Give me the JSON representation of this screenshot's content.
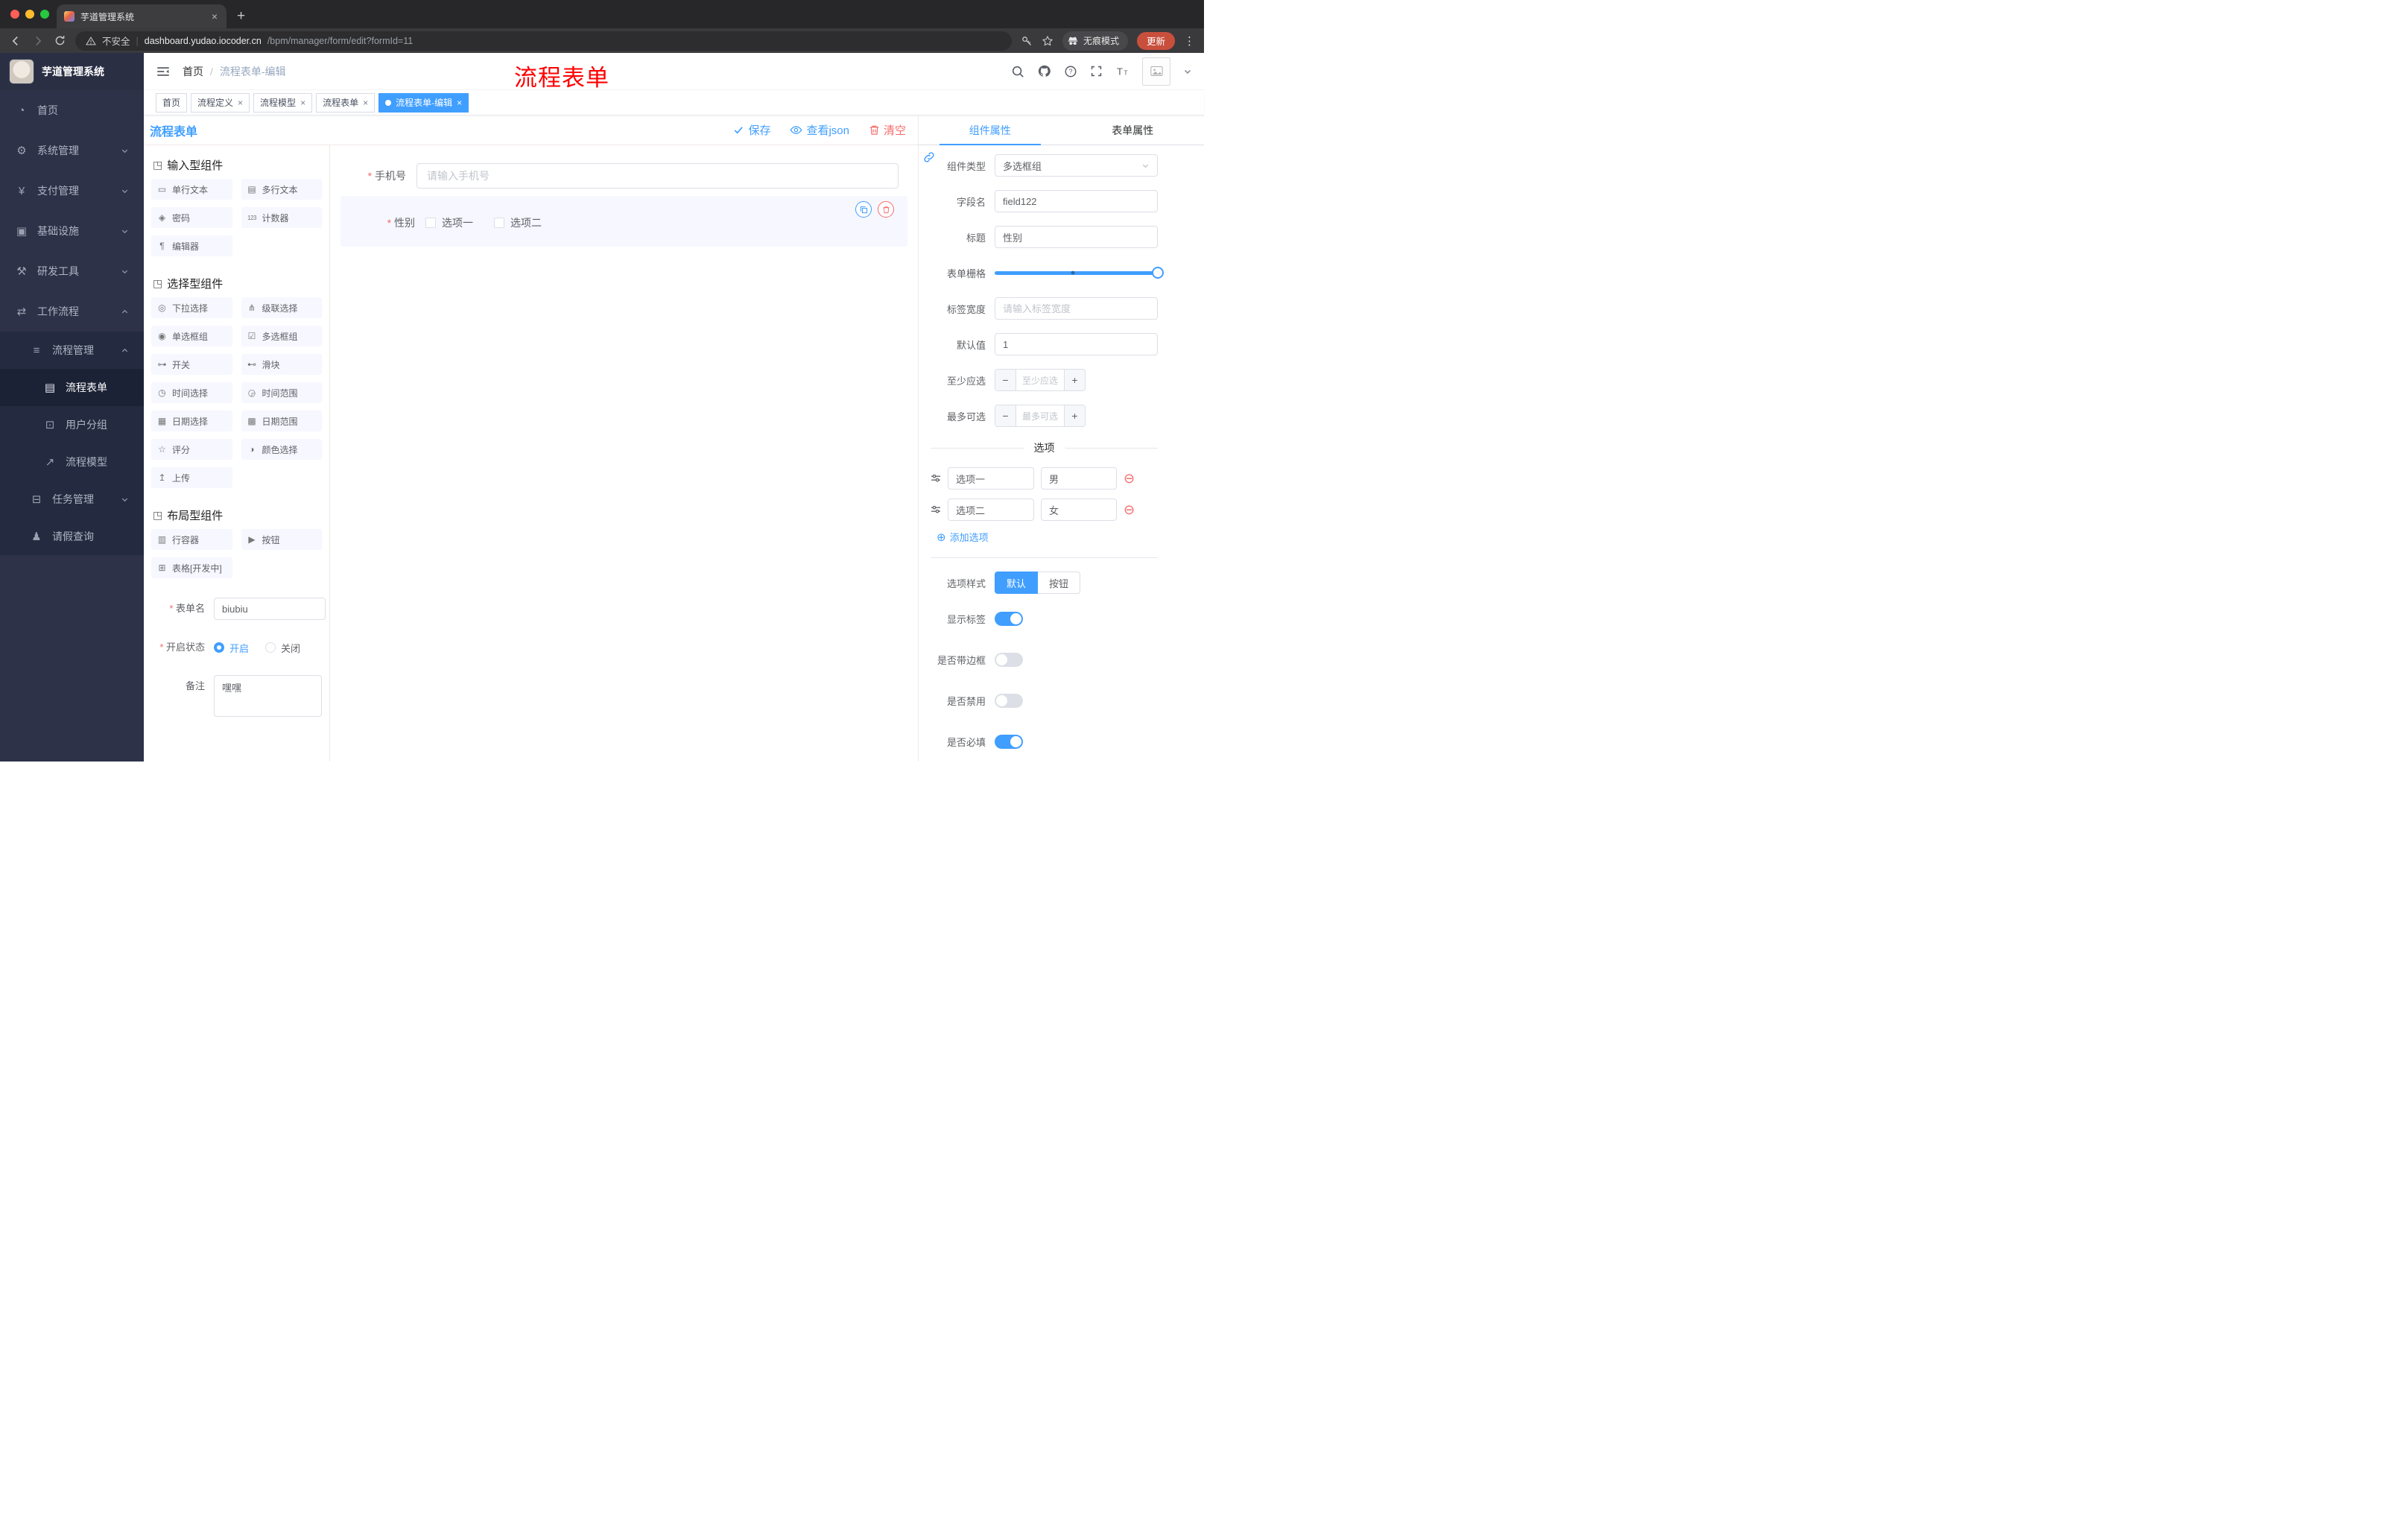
{
  "colors": {
    "primary": "#409eff",
    "danger": "#f56c6c",
    "annotation_red": "#fe0000",
    "sidebar_bg": "#2d3248",
    "selected_item_bg": "#f6f7ff"
  },
  "browser": {
    "tab_title": "芋道管理系统",
    "security_label": "不安全",
    "url_domain": "dashboard.yudao.iocoder.cn",
    "url_path": "/bpm/manager/form/edit?formId=11",
    "incognito_label": "无痕模式",
    "update_label": "更新"
  },
  "sidebar": {
    "logo_title": "芋道管理系统",
    "menu": [
      "首页",
      "系统管理",
      "支付管理",
      "基础设施",
      "研发工具",
      "工作流程"
    ],
    "process_group": "流程管理",
    "process_children": [
      "流程表单",
      "用户分组",
      "流程模型"
    ],
    "task_group": "任务管理",
    "leave_item": "请假查询"
  },
  "header": {
    "breadcrumb_home": "首页",
    "breadcrumb_separator": "/",
    "breadcrumb_current": "流程表单-编辑",
    "annotation": "流程表单"
  },
  "tags": [
    "首页",
    "流程定义",
    "流程模型",
    "流程表单",
    "流程表单-编辑"
  ],
  "editor": {
    "title": "流程表单",
    "save": "保存",
    "view_json": "查看json",
    "clear": "清空"
  },
  "palette": {
    "group_input": "输入型组件",
    "input_items": [
      "单行文本",
      "多行文本",
      "密码",
      "计数器",
      "编辑器"
    ],
    "group_select": "选择型组件",
    "select_items": [
      "下拉选择",
      "级联选择",
      "单选框组",
      "多选框组",
      "开关",
      "滑块",
      "时间选择",
      "时间范围",
      "日期选择",
      "日期范围",
      "评分",
      "颜色选择",
      "上传"
    ],
    "group_layout": "布局型组件",
    "layout_items": [
      "行容器",
      "按钮",
      "表格[开发中]"
    ],
    "form_name_label": "表单名",
    "form_name_value": "biubiu",
    "status_label": "开启状态",
    "status_on": "开启",
    "status_off": "关闭",
    "remark_label": "备注",
    "remark_value": "嘿嘿"
  },
  "canvas": {
    "phone_label": "手机号",
    "phone_placeholder": "请输入手机号",
    "gender_label": "性别",
    "gender_option1": "选项一",
    "gender_option2": "选项二"
  },
  "panel": {
    "tab_component": "组件属性",
    "tab_form": "表单属性",
    "component_type_label": "组件类型",
    "component_type_value": "多选框组",
    "field_name_label": "字段名",
    "field_name_value": "field122",
    "title_label": "标题",
    "title_value": "性别",
    "grid_label": "表单栅格",
    "label_width_label": "标签宽度",
    "label_width_placeholder": "请输入标签宽度",
    "default_label": "默认值",
    "default_value": "1",
    "min_label": "至少应选",
    "min_placeholder": "至少应选",
    "max_label": "最多可选",
    "max_placeholder": "最多可选",
    "options_title": "选项",
    "option1_label": "选项一",
    "option1_value": "男",
    "option2_label": "选项二",
    "option2_value": "女",
    "add_option": "添加选项",
    "option_style_label": "选项样式",
    "style_default": "默认",
    "style_button": "按钮",
    "switch_show_label": "显示标签",
    "switch_border": "是否带边框",
    "switch_disabled": "是否禁用",
    "switch_required": "是否必填",
    "switch_states": {
      "show_label": true,
      "border": false,
      "disabled": false,
      "required": true
    }
  }
}
